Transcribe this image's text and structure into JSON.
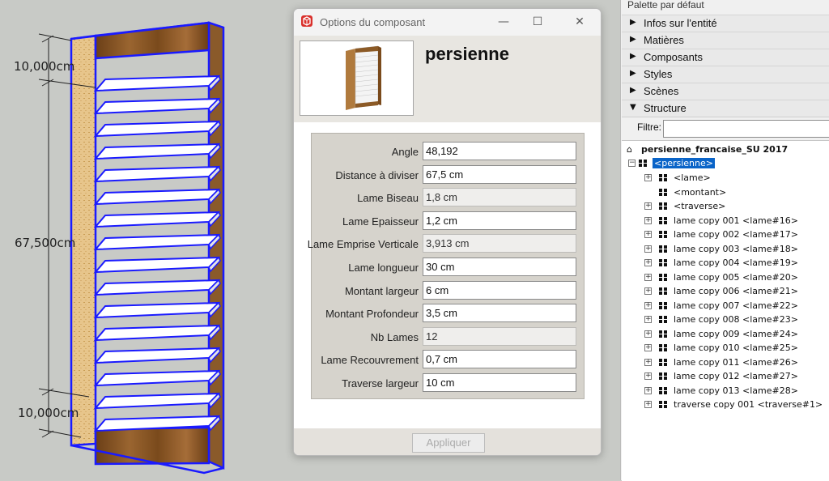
{
  "viewport": {
    "dimensions": [
      "10,000cm",
      "67,500cm",
      "10,000cm"
    ]
  },
  "dialog": {
    "title": "Options du composant",
    "component_name": "persienne",
    "params": [
      {
        "label": "Angle",
        "value": "48,192",
        "editable": true
      },
      {
        "label": "Distance à diviser",
        "value": "67,5 cm",
        "editable": true
      },
      {
        "label": "Lame Biseau",
        "value": "1,8 cm",
        "editable": false
      },
      {
        "label": "Lame Epaisseur",
        "value": "1,2 cm",
        "editable": true
      },
      {
        "label": "Lame Emprise Verticale",
        "value": "3,913 cm",
        "editable": false
      },
      {
        "label": "Lame longueur",
        "value": "30 cm",
        "editable": true
      },
      {
        "label": "Montant largeur",
        "value": "6 cm",
        "editable": true
      },
      {
        "label": "Montant Profondeur",
        "value": "3,5 cm",
        "editable": true
      },
      {
        "label": "Nb Lames",
        "value": "12",
        "editable": false
      },
      {
        "label": "Lame Recouvrement",
        "value": "0,7 cm",
        "editable": true
      },
      {
        "label": "Traverse largeur",
        "value": "10 cm",
        "editable": true
      }
    ],
    "apply_label": "Appliquer",
    "minimize_icon": "minimize-icon",
    "maximize_icon": "maximize-icon",
    "close_icon": "close-icon"
  },
  "panel": {
    "title": "Palette par défaut",
    "sections": [
      {
        "label": "Infos sur l'entité",
        "expanded": false
      },
      {
        "label": "Matières",
        "expanded": false
      },
      {
        "label": "Composants",
        "expanded": false
      },
      {
        "label": "Styles",
        "expanded": false
      },
      {
        "label": "Scènes",
        "expanded": false
      },
      {
        "label": "Structure",
        "expanded": true
      }
    ],
    "filter_label": "Filtre:",
    "filter_value": "",
    "tree": {
      "model": "persienne_francaise_SU 2017",
      "root": "<persienne>",
      "children": [
        {
          "label": "<lame>",
          "expander": true
        },
        {
          "label": "<montant>",
          "expander": false
        },
        {
          "label": "<traverse>",
          "expander": true
        },
        {
          "label": "lame copy 001 <lame#16>",
          "expander": true
        },
        {
          "label": "lame copy 002 <lame#17>",
          "expander": true
        },
        {
          "label": "lame copy 003 <lame#18>",
          "expander": true
        },
        {
          "label": "lame copy 004 <lame#19>",
          "expander": true
        },
        {
          "label": "lame copy 005 <lame#20>",
          "expander": true
        },
        {
          "label": "lame copy 006 <lame#21>",
          "expander": true
        },
        {
          "label": "lame copy 007 <lame#22>",
          "expander": true
        },
        {
          "label": "lame copy 008 <lame#23>",
          "expander": true
        },
        {
          "label": "lame copy 009 <lame#24>",
          "expander": true
        },
        {
          "label": "lame copy 010 <lame#25>",
          "expander": true
        },
        {
          "label": "lame copy 011 <lame#26>",
          "expander": true
        },
        {
          "label": "lame copy 012 <lame#27>",
          "expander": true
        },
        {
          "label": "lame copy 013 <lame#28>",
          "expander": true
        },
        {
          "label": "traverse copy 001 <traverse#1>",
          "expander": true
        }
      ]
    }
  },
  "colors": {
    "selection": "#0a64c8",
    "wood": "#7a4e23",
    "outline": "#1a1aff"
  }
}
